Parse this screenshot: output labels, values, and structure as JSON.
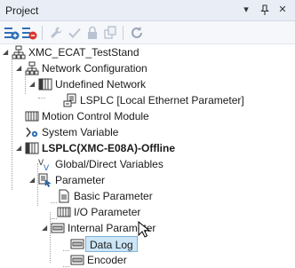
{
  "panel": {
    "title": "Project",
    "controls": {
      "dropdown": "▾",
      "pin": "ᵖ",
      "close": "✕"
    }
  },
  "toolbar": {
    "tools": [
      "expand-all-icon",
      "collapse-all-icon",
      "wrench-icon",
      "check-icon",
      "lock-icon",
      "copy-icon",
      "refresh-icon"
    ]
  },
  "tree": {
    "root": "XMC_ECAT_TestStand",
    "network_configuration": "Network Configuration",
    "undefined_network": "Undefined Network",
    "lsplc_ethernet": "LSPLC [Local Ethernet Parameter]",
    "motion_control_module": "Motion Control Module",
    "system_variable": "System Variable",
    "plc": "LSPLC(XMC-E08A)-Offline",
    "global_direct_variables": "Global/Direct Variables",
    "parameter": "Parameter",
    "basic_parameter": "Basic Parameter",
    "io_parameter": "I/O Parameter",
    "internal_parameter": "Internal Parameter",
    "data_log": "Data Log",
    "encoder": "Encoder"
  },
  "colors": {
    "accent_blue": "#2f6fb5",
    "selection_bg": "#cde6f7",
    "selection_border": "#7fb2dc",
    "toolbar_red": "#d9342b",
    "refresh_gray": "#9aa6b5"
  }
}
